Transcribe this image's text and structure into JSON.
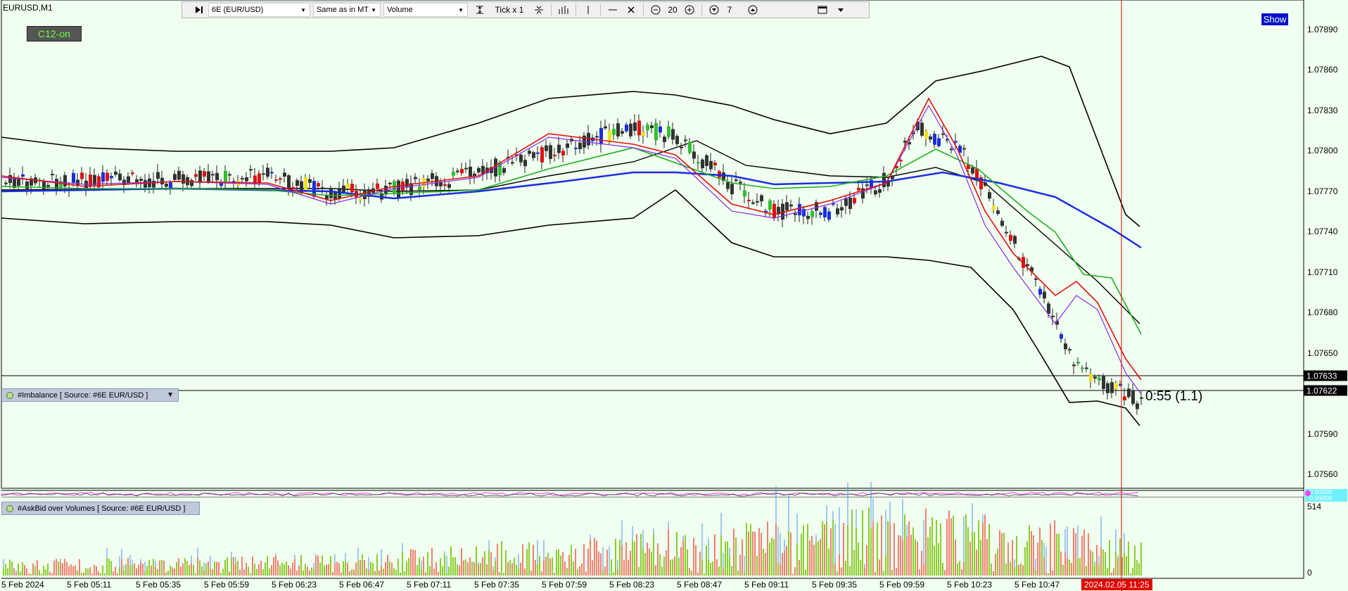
{
  "window": {
    "title": "EURUSD,M1"
  },
  "toolbar": {
    "symbol": "6E (EUR/USD)",
    "timezone": "Same as in MT",
    "mode": "Volume",
    "tick_label": "Tick x 1",
    "zoom_value": "20",
    "depth_value": "7",
    "icons": [
      "play-icon",
      "tick-settings-icon",
      "tick-adjust-icon",
      "bar-chart-icon",
      "vertical-line-icon",
      "horizontal-line-icon",
      "close-x-icon",
      "zoom-out-icon",
      "zoom-in-icon",
      "decrease-icon",
      "increase-icon",
      "window-icon",
      "menu-caret-icon"
    ]
  },
  "overlay": {
    "c12_label": "C12-on",
    "show_label": "Show",
    "countdown": "0:55 (1.1)"
  },
  "price_axis": {
    "labels": [
      "1.07890",
      "1.07860",
      "1.07830",
      "1.07800",
      "1.07770",
      "1.07740",
      "1.07710",
      "1.07680",
      "1.07650",
      "1.07590",
      "1.07560"
    ],
    "tag_ask": "1.07633",
    "tag_bid": "1.07622"
  },
  "indicators": {
    "imbalance_label": "#Imbalance [ Source: #6E EUR/USD ]",
    "osc_values": [
      "0.00000",
      "0.00000"
    ],
    "askbid_label": "#AskBid over Volumes [ Source: #6E EUR/USD ]",
    "vol_max": "514",
    "vol_zero": "0"
  },
  "time_axis": {
    "labels": [
      "5 Feb 2024",
      "5 Feb 05:11",
      "5 Feb 05:35",
      "5 Feb 05:59",
      "5 Feb 06:23",
      "5 Feb 06:47",
      "5 Feb 07:11",
      "5 Feb 07:35",
      "5 Feb 07:59",
      "5 Feb 08:23",
      "5 Feb 08:47",
      "5 Feb 09:11",
      "5 Feb 09:35",
      "5 Feb 09:59",
      "5 Feb 10:23",
      "5 Feb 10:47"
    ],
    "current": "2024.02.05 11:25"
  },
  "colors": {
    "background": "#f0fff0",
    "ma_blue": "#1a2ee0",
    "ma_green": "#22b022",
    "ma_red": "#e01010",
    "ma_purple": "#8a2be2",
    "bands": "#000000",
    "cursor_line": "#e00000",
    "vol_up": "#8ccc2c",
    "vol_down": "#f08070"
  }
}
